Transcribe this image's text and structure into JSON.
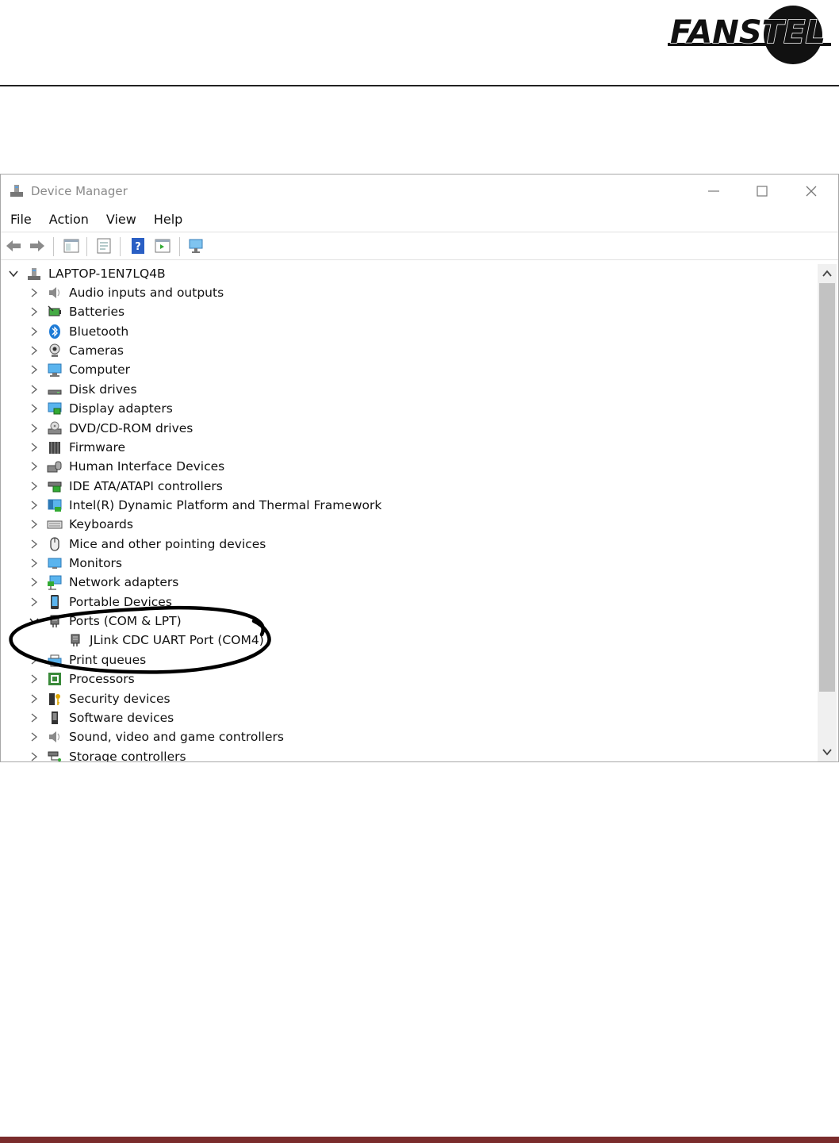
{
  "window": {
    "title": "Device Manager",
    "menu": [
      "File",
      "Action",
      "View",
      "Help"
    ]
  },
  "tree": {
    "root": "LAPTOP-1EN7LQ4B",
    "items": [
      {
        "label": "Audio inputs and outputs",
        "icon": "speaker-icon"
      },
      {
        "label": "Batteries",
        "icon": "battery-icon"
      },
      {
        "label": "Bluetooth",
        "icon": "bluetooth-icon"
      },
      {
        "label": "Cameras",
        "icon": "camera-icon"
      },
      {
        "label": "Computer",
        "icon": "computer-icon"
      },
      {
        "label": "Disk drives",
        "icon": "disk-drive-icon"
      },
      {
        "label": "Display adapters",
        "icon": "display-adapter-icon"
      },
      {
        "label": "DVD/CD-ROM drives",
        "icon": "dvd-icon"
      },
      {
        "label": "Firmware",
        "icon": "firmware-icon"
      },
      {
        "label": "Human Interface Devices",
        "icon": "hid-icon"
      },
      {
        "label": "IDE ATA/ATAPI controllers",
        "icon": "ide-controller-icon"
      },
      {
        "label": "Intel(R) Dynamic Platform and Thermal Framework",
        "icon": "thermal-framework-icon"
      },
      {
        "label": "Keyboards",
        "icon": "keyboard-icon"
      },
      {
        "label": "Mice and other pointing devices",
        "icon": "mouse-icon"
      },
      {
        "label": "Monitors",
        "icon": "monitor-icon"
      },
      {
        "label": "Network adapters",
        "icon": "network-adapter-icon"
      },
      {
        "label": "Portable Devices",
        "icon": "portable-device-icon"
      },
      {
        "label": "Ports (COM & LPT)",
        "icon": "port-icon"
      },
      {
        "label": "JLink CDC UART Port (COM4)",
        "icon": "port-icon"
      },
      {
        "label": "Print queues",
        "icon": "printer-icon"
      },
      {
        "label": "Processors",
        "icon": "processor-icon"
      },
      {
        "label": "Security devices",
        "icon": "security-device-icon"
      },
      {
        "label": "Software devices",
        "icon": "software-device-icon"
      },
      {
        "label": "Sound, video and game controllers",
        "icon": "sound-icon"
      },
      {
        "label": "Storage controllers",
        "icon": "storage-controller-icon"
      }
    ]
  },
  "colors": {
    "footer_rule": "#7a2c2c",
    "callout": "#000000",
    "accent_blue": "#1e7bd6"
  }
}
